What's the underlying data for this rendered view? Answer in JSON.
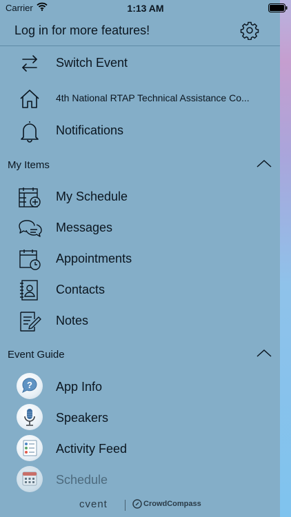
{
  "status_bar": {
    "carrier": "Carrier",
    "time": "1:13 AM"
  },
  "header": {
    "login_label": "Log in for more features!"
  },
  "top_items": [
    {
      "label": "Switch Event",
      "icon": "switch-arrows-icon"
    },
    {
      "label": "4th National RTAP Technical Assistance Co...",
      "icon": "home-icon"
    },
    {
      "label": "Notifications",
      "icon": "bell-icon"
    }
  ],
  "my_items": {
    "title": "My Items",
    "items": [
      {
        "label": "My Schedule",
        "icon": "calendar-add-icon"
      },
      {
        "label": "Messages",
        "icon": "chat-bubbles-icon"
      },
      {
        "label": "Appointments",
        "icon": "calendar-clock-icon"
      },
      {
        "label": "Contacts",
        "icon": "contact-book-icon"
      },
      {
        "label": "Notes",
        "icon": "note-pen-icon"
      }
    ]
  },
  "event_guide": {
    "title": "Event Guide",
    "items": [
      {
        "label": "App Info",
        "icon": "question-bubble-icon"
      },
      {
        "label": "Speakers",
        "icon": "microphone-icon"
      },
      {
        "label": "Activity Feed",
        "icon": "activity-feed-icon"
      },
      {
        "label": "Schedule",
        "icon": "calendar-grid-icon"
      }
    ]
  },
  "footer": {
    "brand": "cvent",
    "partner": "CrowdCompass"
  },
  "colors": {
    "panel": "#84aec8",
    "text": "#0b1620",
    "accent_red": "#e05a4a"
  }
}
